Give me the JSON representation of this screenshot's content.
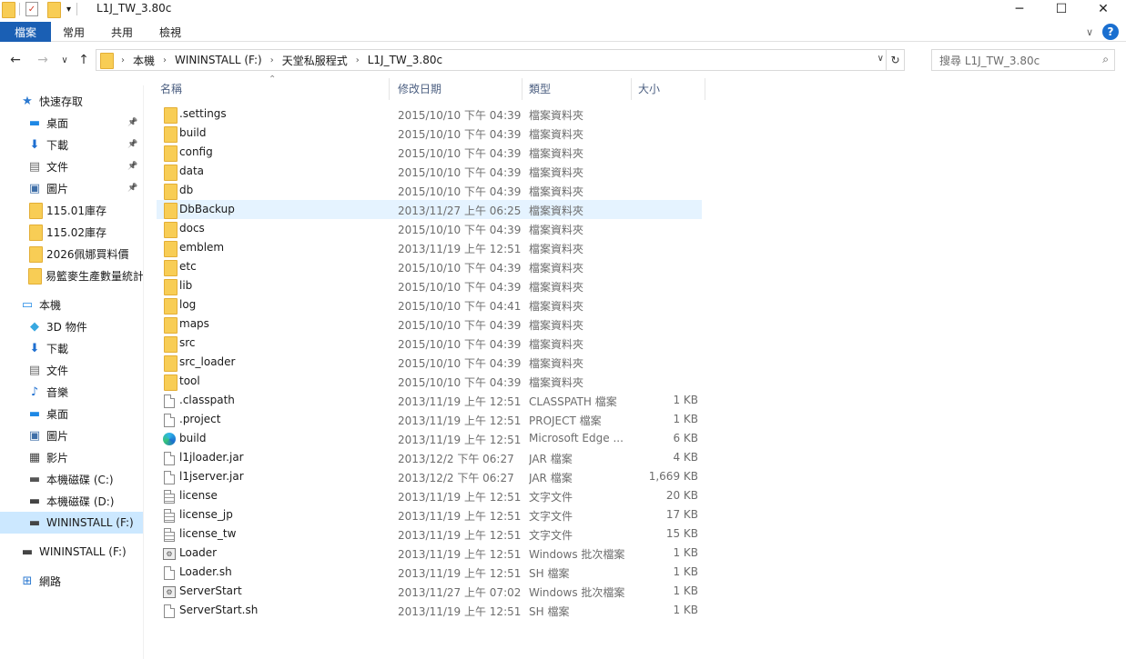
{
  "window": {
    "title": "L1J_TW_3.80c",
    "controls": [
      "─",
      "☐",
      "✕"
    ]
  },
  "ribbon": {
    "tabs": [
      "檔案",
      "常用",
      "共用",
      "檢視"
    ],
    "expand_icon": "chevron-down-icon",
    "help_label": "?"
  },
  "address": {
    "crumbs": [
      "本機",
      "WININSTALL (F:)",
      "天堂私服程式",
      "L1J_TW_3.80c"
    ],
    "search_placeholder": "搜尋 L1J_TW_3.80c"
  },
  "sidebar": {
    "items": [
      {
        "label": "快速存取",
        "icon": "star-icon",
        "pinned": false
      },
      {
        "label": "桌面",
        "icon": "desktop-icon",
        "pinned": true
      },
      {
        "label": "下載",
        "icon": "download-icon",
        "pinned": true
      },
      {
        "label": "文件",
        "icon": "document-icon",
        "pinned": true
      },
      {
        "label": "圖片",
        "icon": "picture-icon",
        "pinned": true
      },
      {
        "label": "115.01庫存",
        "icon": "folder-icon",
        "pinned": false
      },
      {
        "label": "115.02庫存",
        "icon": "folder-icon",
        "pinned": false
      },
      {
        "label": "2026佩娜買料價",
        "icon": "folder-icon",
        "pinned": false
      },
      {
        "label": "易籃麥生產數量統計",
        "icon": "folder-icon",
        "pinned": false
      },
      {
        "label": "本機",
        "icon": "pc-icon",
        "pinned": false
      },
      {
        "label": "3D 物件",
        "icon": "cube-icon",
        "pinned": false
      },
      {
        "label": "下載",
        "icon": "download-icon",
        "pinned": false
      },
      {
        "label": "文件",
        "icon": "document-icon",
        "pinned": false
      },
      {
        "label": "音樂",
        "icon": "music-icon",
        "pinned": false
      },
      {
        "label": "桌面",
        "icon": "desktop-icon",
        "pinned": false
      },
      {
        "label": "圖片",
        "icon": "picture-icon",
        "pinned": false
      },
      {
        "label": "影片",
        "icon": "film-icon",
        "pinned": false
      },
      {
        "label": "本機磁碟 (C:)",
        "icon": "windows-drive-icon",
        "pinned": false
      },
      {
        "label": "本機磁碟 (D:)",
        "icon": "drive-icon",
        "pinned": false
      },
      {
        "label": "WININSTALL (F:)",
        "icon": "drive-icon",
        "pinned": false,
        "selected": true
      },
      {
        "label": "WININSTALL (F:)",
        "icon": "drive-icon",
        "pinned": false
      },
      {
        "label": "網路",
        "icon": "network-icon",
        "pinned": false
      }
    ]
  },
  "columns": {
    "name": "名稱",
    "date": "修改日期",
    "type": "類型",
    "size": "大小"
  },
  "files": [
    {
      "name": ".settings",
      "date": "2015/10/10 下午 04:39",
      "type": "檔案資料夾",
      "size": "",
      "icon": "folder-icon"
    },
    {
      "name": "build",
      "date": "2015/10/10 下午 04:39",
      "type": "檔案資料夾",
      "size": "",
      "icon": "folder-icon"
    },
    {
      "name": "config",
      "date": "2015/10/10 下午 04:39",
      "type": "檔案資料夾",
      "size": "",
      "icon": "folder-icon"
    },
    {
      "name": "data",
      "date": "2015/10/10 下午 04:39",
      "type": "檔案資料夾",
      "size": "",
      "icon": "folder-icon"
    },
    {
      "name": "db",
      "date": "2015/10/10 下午 04:39",
      "type": "檔案資料夾",
      "size": "",
      "icon": "folder-icon"
    },
    {
      "name": "DbBackup",
      "date": "2013/11/27 上午 06:25",
      "type": "檔案資料夾",
      "size": "",
      "icon": "folder-icon",
      "hover": true
    },
    {
      "name": "docs",
      "date": "2015/10/10 下午 04:39",
      "type": "檔案資料夾",
      "size": "",
      "icon": "folder-icon"
    },
    {
      "name": "emblem",
      "date": "2013/11/19 上午 12:51",
      "type": "檔案資料夾",
      "size": "",
      "icon": "folder-icon"
    },
    {
      "name": "etc",
      "date": "2015/10/10 下午 04:39",
      "type": "檔案資料夾",
      "size": "",
      "icon": "folder-icon"
    },
    {
      "name": "lib",
      "date": "2015/10/10 下午 04:39",
      "type": "檔案資料夾",
      "size": "",
      "icon": "folder-icon"
    },
    {
      "name": "log",
      "date": "2015/10/10 下午 04:41",
      "type": "檔案資料夾",
      "size": "",
      "icon": "folder-icon"
    },
    {
      "name": "maps",
      "date": "2015/10/10 下午 04:39",
      "type": "檔案資料夾",
      "size": "",
      "icon": "folder-icon"
    },
    {
      "name": "src",
      "date": "2015/10/10 下午 04:39",
      "type": "檔案資料夾",
      "size": "",
      "icon": "folder-icon"
    },
    {
      "name": "src_loader",
      "date": "2015/10/10 下午 04:39",
      "type": "檔案資料夾",
      "size": "",
      "icon": "folder-icon"
    },
    {
      "name": "tool",
      "date": "2015/10/10 下午 04:39",
      "type": "檔案資料夾",
      "size": "",
      "icon": "folder-icon"
    },
    {
      "name": ".classpath",
      "date": "2013/11/19 上午 12:51",
      "type": "CLASSPATH 檔案",
      "size": "1 KB",
      "icon": "file-icon"
    },
    {
      "name": ".project",
      "date": "2013/11/19 上午 12:51",
      "type": "PROJECT 檔案",
      "size": "1 KB",
      "icon": "file-icon"
    },
    {
      "name": "build",
      "date": "2013/11/19 上午 12:51",
      "type": "Microsoft Edge ...",
      "size": "6 KB",
      "icon": "edge-icon"
    },
    {
      "name": "l1jloader.jar",
      "date": "2013/12/2 下午 06:27",
      "type": "JAR 檔案",
      "size": "4 KB",
      "icon": "file-icon"
    },
    {
      "name": "l1jserver.jar",
      "date": "2013/12/2 下午 06:27",
      "type": "JAR 檔案",
      "size": "1,669 KB",
      "icon": "file-icon"
    },
    {
      "name": "license",
      "date": "2013/11/19 上午 12:51",
      "type": "文字文件",
      "size": "20 KB",
      "icon": "text-file-icon"
    },
    {
      "name": "license_jp",
      "date": "2013/11/19 上午 12:51",
      "type": "文字文件",
      "size": "17 KB",
      "icon": "text-file-icon"
    },
    {
      "name": "license_tw",
      "date": "2013/11/19 上午 12:51",
      "type": "文字文件",
      "size": "15 KB",
      "icon": "text-file-icon"
    },
    {
      "name": "Loader",
      "date": "2013/11/19 上午 12:51",
      "type": "Windows 批次檔案",
      "size": "1 KB",
      "icon": "batch-file-icon"
    },
    {
      "name": "Loader.sh",
      "date": "2013/11/19 上午 12:51",
      "type": "SH 檔案",
      "size": "1 KB",
      "icon": "file-icon"
    },
    {
      "name": "ServerStart",
      "date": "2013/11/27 上午 07:02",
      "type": "Windows 批次檔案",
      "size": "1 KB",
      "icon": "batch-file-icon"
    },
    {
      "name": "ServerStart.sh",
      "date": "2013/11/19 上午 12:51",
      "type": "SH 檔案",
      "size": "1 KB",
      "icon": "file-icon"
    }
  ]
}
